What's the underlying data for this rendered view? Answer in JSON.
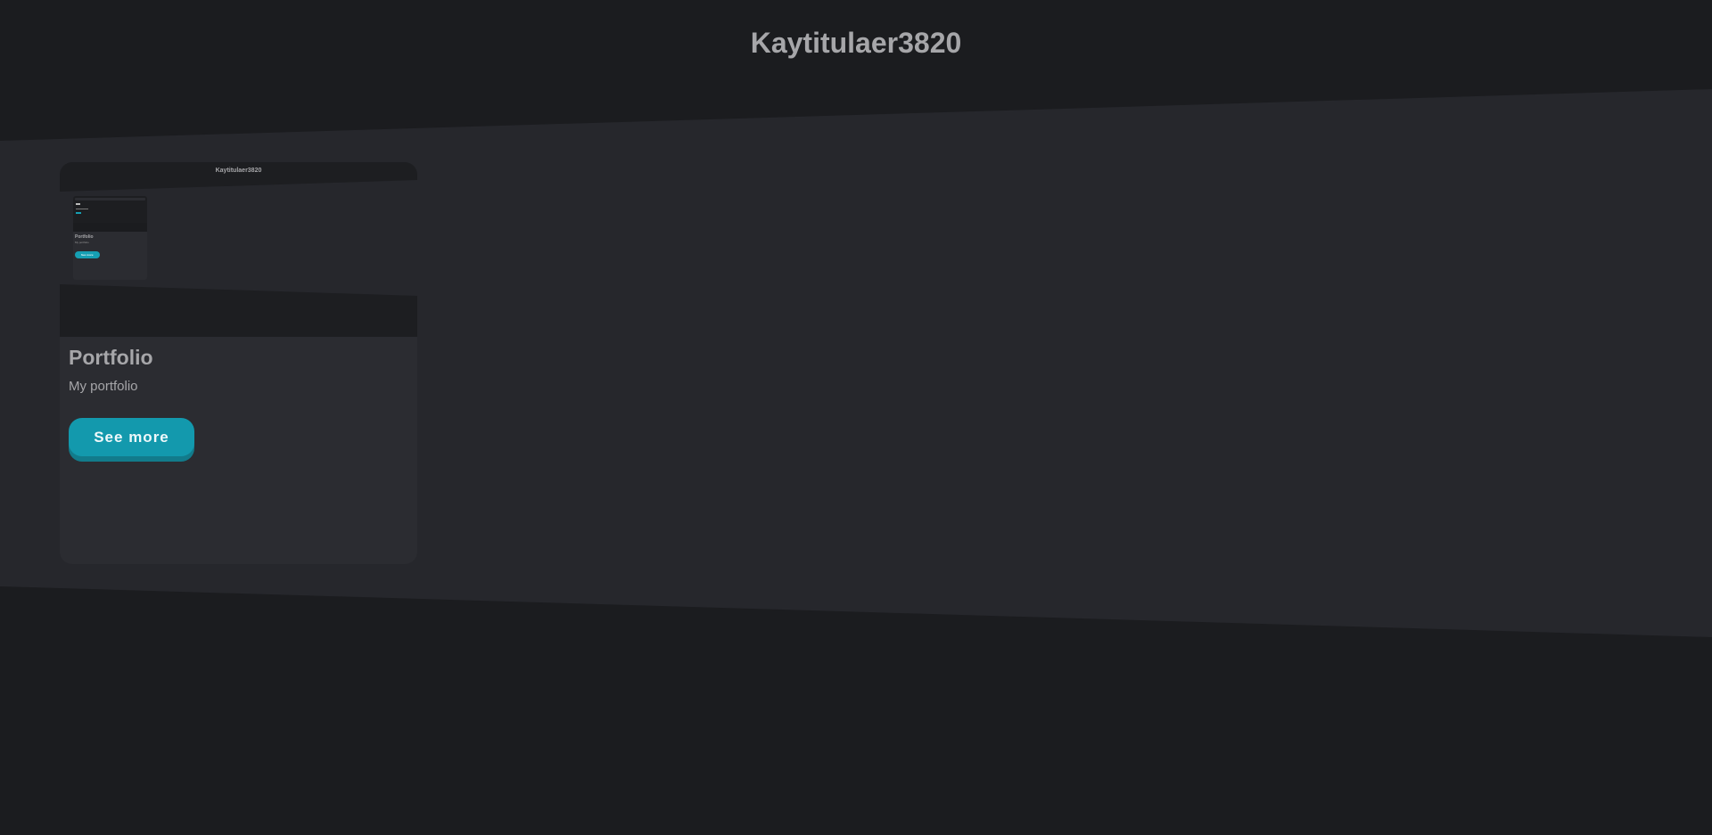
{
  "site": {
    "title": "Kaytitulaer3820"
  },
  "projects": [
    {
      "preview": {
        "title": "Kaytitulaer3820",
        "mini_title": "Portfolio",
        "mini_description": "My portfolio",
        "mini_button": "See more"
      },
      "title": "Portfolio",
      "description": "My portfolio",
      "button_label": "See more"
    }
  ],
  "colors": {
    "background": "#1b1c1f",
    "band": "#26272c",
    "card": "#2b2c31",
    "accent": "#1399ad",
    "text": "#a6a6a9"
  }
}
